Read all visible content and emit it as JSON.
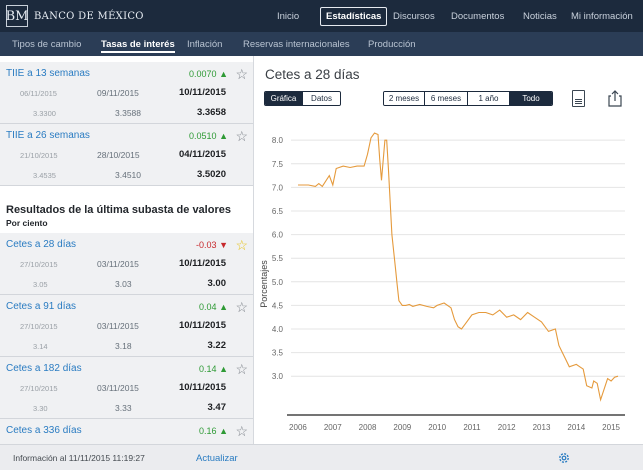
{
  "brand": {
    "logo_mark": "BM",
    "name": "BANCO DE MÉXICO"
  },
  "top_nav": [
    {
      "label": "Inicio",
      "active": false
    },
    {
      "label": "Estadísticas",
      "active": true
    },
    {
      "label": "Discursos",
      "active": false
    },
    {
      "label": "Documentos",
      "active": false
    },
    {
      "label": "Noticias",
      "active": false
    },
    {
      "label": "Mi información",
      "active": false
    }
  ],
  "sub_nav": [
    {
      "label": "Tipos de cambio",
      "active": false
    },
    {
      "label": "Tasas de interés",
      "active": true
    },
    {
      "label": "Inflación",
      "active": false
    },
    {
      "label": "Reservas internacionales",
      "active": false
    },
    {
      "label": "Producción",
      "active": false
    }
  ],
  "tiie_cards": [
    {
      "name": "TIIE a 13 semanas",
      "change": "0.0070",
      "direction": "up",
      "favorite": false,
      "dates": [
        "06/11/2015",
        "09/11/2015",
        "10/11/2015"
      ],
      "values": [
        "3.3300",
        "3.3588",
        "3.3658"
      ]
    },
    {
      "name": "TIIE a 26 semanas",
      "change": "0.0510",
      "direction": "up",
      "favorite": false,
      "dates": [
        "21/10/2015",
        "28/10/2015",
        "04/11/2015"
      ],
      "values": [
        "3.4535",
        "3.4510",
        "3.5020"
      ]
    }
  ],
  "auction_section": {
    "title": "Resultados de la última subasta de valores",
    "subtitle": "Por ciento"
  },
  "auction_cards": [
    {
      "name": "Cetes a 28 días",
      "change": "-0.03",
      "direction": "down",
      "favorite": true,
      "dates": [
        "27/10/2015",
        "03/11/2015",
        "10/11/2015"
      ],
      "values": [
        "3.05",
        "3.03",
        "3.00"
      ]
    },
    {
      "name": "Cetes a 91 días",
      "change": "0.04",
      "direction": "up",
      "favorite": false,
      "dates": [
        "27/10/2015",
        "03/11/2015",
        "10/11/2015"
      ],
      "values": [
        "3.14",
        "3.18",
        "3.22"
      ]
    },
    {
      "name": "Cetes a 182 días",
      "change": "0.14",
      "direction": "up",
      "favorite": false,
      "dates": [
        "27/10/2015",
        "03/11/2015",
        "10/11/2015"
      ],
      "values": [
        "3.30",
        "3.33",
        "3.47"
      ]
    },
    {
      "name": "Cetes a 336 días",
      "change": "0.16",
      "direction": "up",
      "favorite": false,
      "dates": [],
      "values": []
    }
  ],
  "detail": {
    "title": "Cetes a 28 días",
    "view_toggle": [
      {
        "label": "Gráfica",
        "selected": true
      },
      {
        "label": "Datos",
        "selected": false
      }
    ],
    "range_toggle": [
      {
        "label": "2 meses",
        "selected": false
      },
      {
        "label": "6 meses",
        "selected": false
      },
      {
        "label": "1 año",
        "selected": false
      },
      {
        "label": "Todo",
        "selected": true
      }
    ],
    "icons": {
      "export": "document-icon",
      "share": "share-icon"
    }
  },
  "chart_data": {
    "type": "line",
    "title": "",
    "xlabel": "",
    "ylabel": "Porcentajes",
    "xlim": [
      2005.8,
      2015.4
    ],
    "ylim": [
      2.2,
      8.3
    ],
    "yticks": [
      "3.0",
      "3.5",
      "4.0",
      "4.5",
      "5.0",
      "5.5",
      "6.0",
      "6.5",
      "7.0",
      "7.5",
      "8.0"
    ],
    "xticks": [
      "2006",
      "2007",
      "2008",
      "2009",
      "2010",
      "2011",
      "2012",
      "2013",
      "2014",
      "2015"
    ],
    "grid": true,
    "line_color": "#e59a3c",
    "series": [
      {
        "x": [
          2006.0,
          2006.3,
          2006.5,
          2006.6,
          2006.7,
          2006.9,
          2007.0,
          2007.1,
          2007.3,
          2007.5,
          2007.7,
          2007.9,
          2008.0,
          2008.1,
          2008.2,
          2008.3,
          2008.35,
          2008.4,
          2008.5,
          2008.55,
          2008.6,
          2008.7,
          2008.8,
          2008.85,
          2008.9,
          2009.0,
          2009.1,
          2009.2,
          2009.3,
          2009.5,
          2009.7,
          2009.9,
          2010.0,
          2010.2,
          2010.4,
          2010.5,
          2010.6,
          2010.7,
          2010.8,
          2011.0,
          2011.2,
          2011.4,
          2011.6,
          2011.8,
          2012.0,
          2012.2,
          2012.4,
          2012.6,
          2012.8,
          2013.0,
          2013.2,
          2013.4,
          2013.5,
          2013.6,
          2013.7,
          2013.8,
          2014.0,
          2014.1,
          2014.2,
          2014.3,
          2014.45,
          2014.5,
          2014.6,
          2014.7,
          2014.9,
          2015.0,
          2015.1,
          2015.2
        ],
        "y": [
          7.05,
          7.05,
          7.02,
          7.08,
          7.02,
          7.25,
          7.05,
          7.4,
          7.45,
          7.42,
          7.45,
          7.45,
          7.7,
          8.05,
          8.15,
          8.12,
          7.6,
          7.15,
          8.0,
          8.0,
          7.4,
          6.0,
          5.3,
          4.95,
          4.6,
          4.5,
          4.5,
          4.52,
          4.48,
          4.52,
          4.48,
          4.45,
          4.5,
          4.55,
          4.45,
          4.2,
          4.05,
          4.0,
          4.1,
          4.3,
          4.35,
          4.35,
          4.3,
          4.4,
          4.25,
          4.3,
          4.2,
          4.35,
          4.25,
          4.15,
          3.95,
          4.0,
          3.65,
          3.5,
          3.35,
          3.2,
          3.25,
          3.2,
          3.15,
          2.8,
          2.75,
          2.9,
          2.85,
          2.5,
          2.95,
          2.9,
          2.98,
          3.0
        ]
      }
    ]
  },
  "footer": {
    "info_prefix": "Información al",
    "info_datetime": "11/11/2015 11:19:27",
    "update_label": "Actualizar",
    "settings_icon": "gear-icon"
  }
}
